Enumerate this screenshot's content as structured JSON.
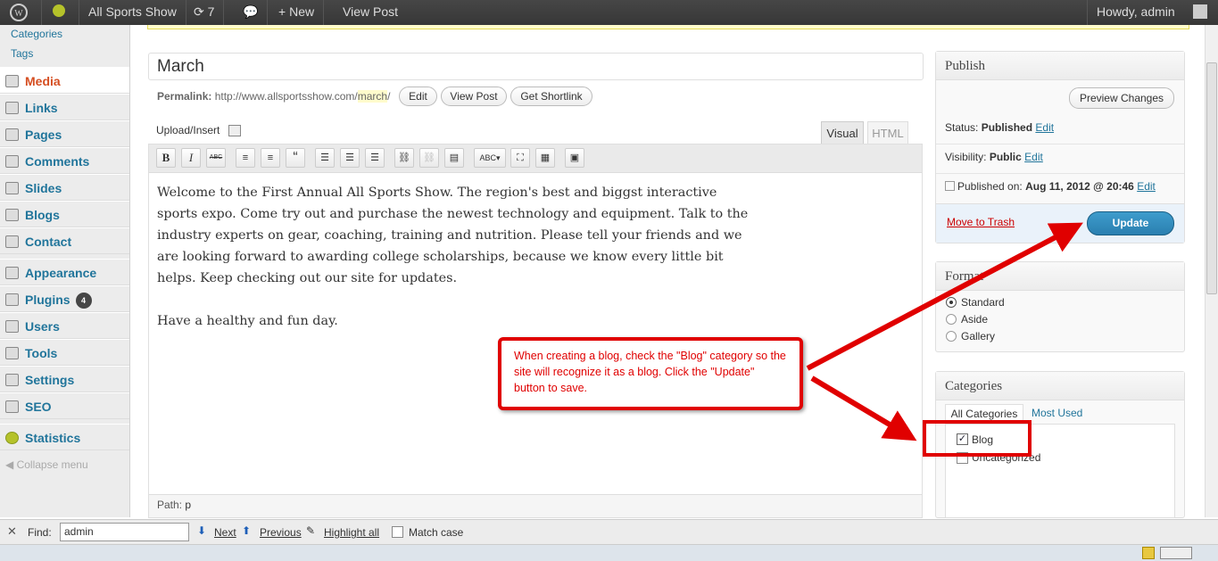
{
  "adminbar": {
    "site_name": "All Sports Show",
    "updates": "7",
    "new": "New",
    "view_post": "View Post",
    "howdy": "Howdy, admin"
  },
  "sidebar": {
    "sub": [
      "Categories",
      "Tags"
    ],
    "items": [
      {
        "label": "Media",
        "icon": "media-icon"
      },
      {
        "label": "Links",
        "icon": "links-icon"
      },
      {
        "label": "Pages",
        "icon": "pages-icon"
      },
      {
        "label": "Comments",
        "icon": "comments-icon"
      },
      {
        "label": "Slides",
        "icon": "slides-icon"
      },
      {
        "label": "Blogs",
        "icon": "blogs-icon"
      },
      {
        "label": "Contact",
        "icon": "contact-icon"
      },
      {
        "label": "Appearance",
        "icon": "appearance-icon"
      },
      {
        "label": "Plugins",
        "icon": "plugins-icon",
        "badge": "4"
      },
      {
        "label": "Users",
        "icon": "users-icon"
      },
      {
        "label": "Tools",
        "icon": "tools-icon"
      },
      {
        "label": "Settings",
        "icon": "settings-icon"
      },
      {
        "label": "SEO",
        "icon": "seo-icon"
      },
      {
        "label": "Statistics",
        "icon": "statistics-icon"
      }
    ],
    "collapse": "Collapse menu"
  },
  "post": {
    "title": "March",
    "permalink_label": "Permalink:",
    "permalink_base": "http://www.allsportsshow.com/",
    "permalink_slug": "march",
    "permalink_end": "/",
    "edit": "Edit",
    "view_post": "View Post",
    "shortlink": "Get Shortlink"
  },
  "editor": {
    "upload": "Upload/Insert",
    "tab_visual": "Visual",
    "tab_html": "HTML",
    "toolbar": {
      "bold": "B",
      "italic": "I",
      "strike": "ABC",
      "quote": "“"
    },
    "lines": [
      "Welcome to the First Annual All Sports Show. The region's best and biggst interactive",
      "sports expo. Come try out and purchase the newest technology and equipment. Talk to the",
      "industry experts on gear, coaching, training and nutrition. Please tell your friends and we",
      "are looking forward to awarding college scholarships, because we know every little bit",
      "helps. Keep checking out our site for updates."
    ],
    "closing": "Have a healthy and fun day.",
    "path_label": "Path:",
    "path_value": "p"
  },
  "publish": {
    "title": "Publish",
    "preview": "Preview Changes",
    "status_label": "Status:",
    "status_value": "Published",
    "edit": "Edit",
    "visibility_label": "Visibility:",
    "visibility_value": "Public",
    "published_label": "Published on:",
    "published_value": "Aug 11, 2012 @ 20:46",
    "trash": "Move to Trash",
    "update": "Update"
  },
  "format": {
    "title": "Format",
    "options": [
      "Standard",
      "Aside",
      "Gallery"
    ],
    "selected": "Standard"
  },
  "categories": {
    "title": "Categories",
    "tab_all": "All Categories",
    "tab_used": "Most Used",
    "items": [
      {
        "label": "Blog",
        "checked": true
      },
      {
        "label": "Uncategorized",
        "checked": false
      }
    ]
  },
  "callout": {
    "text": "When creating a blog, check the \"Blog\" category so the site will recognize it as a blog. Click the \"Update\" button to save.",
    "color": "#e00000"
  },
  "findbar": {
    "label": "Find:",
    "value": "admin",
    "next": "Next",
    "previous": "Previous",
    "highlight": "Highlight all",
    "match": "Match case"
  }
}
